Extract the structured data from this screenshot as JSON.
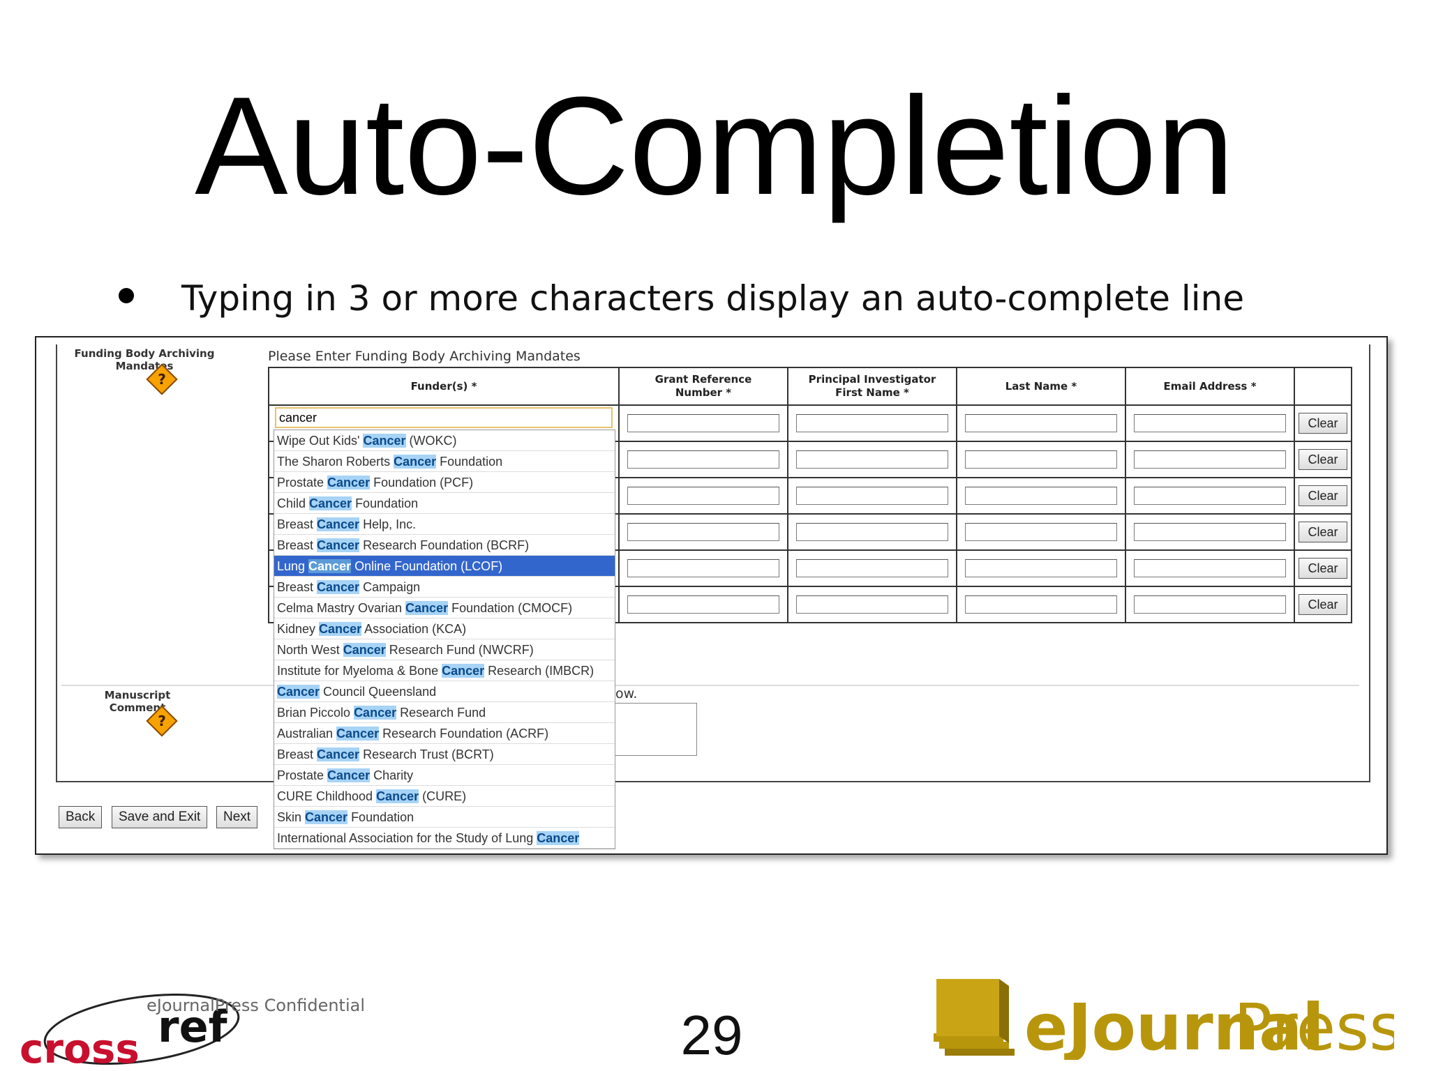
{
  "slide": {
    "title": "Auto-Completion",
    "bullet": "Typing in 3 or more characters display an auto-complete line",
    "confidential": "eJournalPress Confidential",
    "page_number": "29"
  },
  "logos": {
    "crossref_word_left": "cross",
    "crossref_word_right": "ref",
    "ejp_word_bold": "eJournal",
    "ejp_word_light": "Press",
    "ejp_color": "#b8960c",
    "crossref_color": "#c8102e"
  },
  "form": {
    "section_funding_label": "Funding Body Archiving Mandates",
    "section_comment_label": "Manuscript Comment",
    "help_icon_glyph": "?",
    "prompt": "Please Enter Funding Body Archiving Mandates",
    "columns": [
      "Funder(s) *",
      "Grant Reference Number *",
      "Principal Investigator First Name *",
      "Last Name *",
      "Email Address *"
    ],
    "funder_input_value": "cancer",
    "clear_label": "Clear",
    "comment_tail": "ow.",
    "buttons": {
      "back": "Back",
      "save_exit": "Save and Exit",
      "next": "Next"
    }
  },
  "suggestions": [
    {
      "pre": "Wipe Out Kids' ",
      "hl": "Cancer",
      "post": " (WOKC)"
    },
    {
      "pre": "The Sharon Roberts ",
      "hl": "Cancer",
      "post": " Foundation"
    },
    {
      "pre": "Prostate ",
      "hl": "Cancer",
      "post": " Foundation (PCF)"
    },
    {
      "pre": "Child ",
      "hl": "Cancer",
      "post": " Foundation"
    },
    {
      "pre": "Breast ",
      "hl": "Cancer",
      "post": " Help, Inc."
    },
    {
      "pre": "Breast ",
      "hl": "Cancer",
      "post": " Research Foundation (BCRF)"
    },
    {
      "pre": "Lung ",
      "hl": "Cancer",
      "post": " Online Foundation (LCOF)"
    },
    {
      "pre": "Breast ",
      "hl": "Cancer",
      "post": " Campaign"
    },
    {
      "pre": "Celma Mastry Ovarian ",
      "hl": "Cancer",
      "post": " Foundation (CMOCF)"
    },
    {
      "pre": "Kidney ",
      "hl": "Cancer",
      "post": " Association (KCA)"
    },
    {
      "pre": "North West ",
      "hl": "Cancer",
      "post": " Research Fund (NWCRF)"
    },
    {
      "pre": "Institute for Myeloma & Bone ",
      "hl": "Cancer",
      "post": " Research (IMBCR)"
    },
    {
      "pre": "",
      "hl": "Cancer",
      "post": " Council Queensland"
    },
    {
      "pre": "Brian Piccolo ",
      "hl": "Cancer",
      "post": " Research Fund"
    },
    {
      "pre": "Australian ",
      "hl": "Cancer",
      "post": " Research Foundation (ACRF)"
    },
    {
      "pre": "Breast ",
      "hl": "Cancer",
      "post": " Research Trust (BCRT)"
    },
    {
      "pre": "Prostate ",
      "hl": "Cancer",
      "post": " Charity"
    },
    {
      "pre": "CURE Childhood ",
      "hl": "Cancer",
      "post": " (CURE)"
    },
    {
      "pre": "Skin ",
      "hl": "Cancer",
      "post": " Foundation"
    },
    {
      "pre": "International Association for the Study of Lung ",
      "hl": "Cancer",
      "post": ""
    }
  ],
  "active_suggestion_index": 6
}
